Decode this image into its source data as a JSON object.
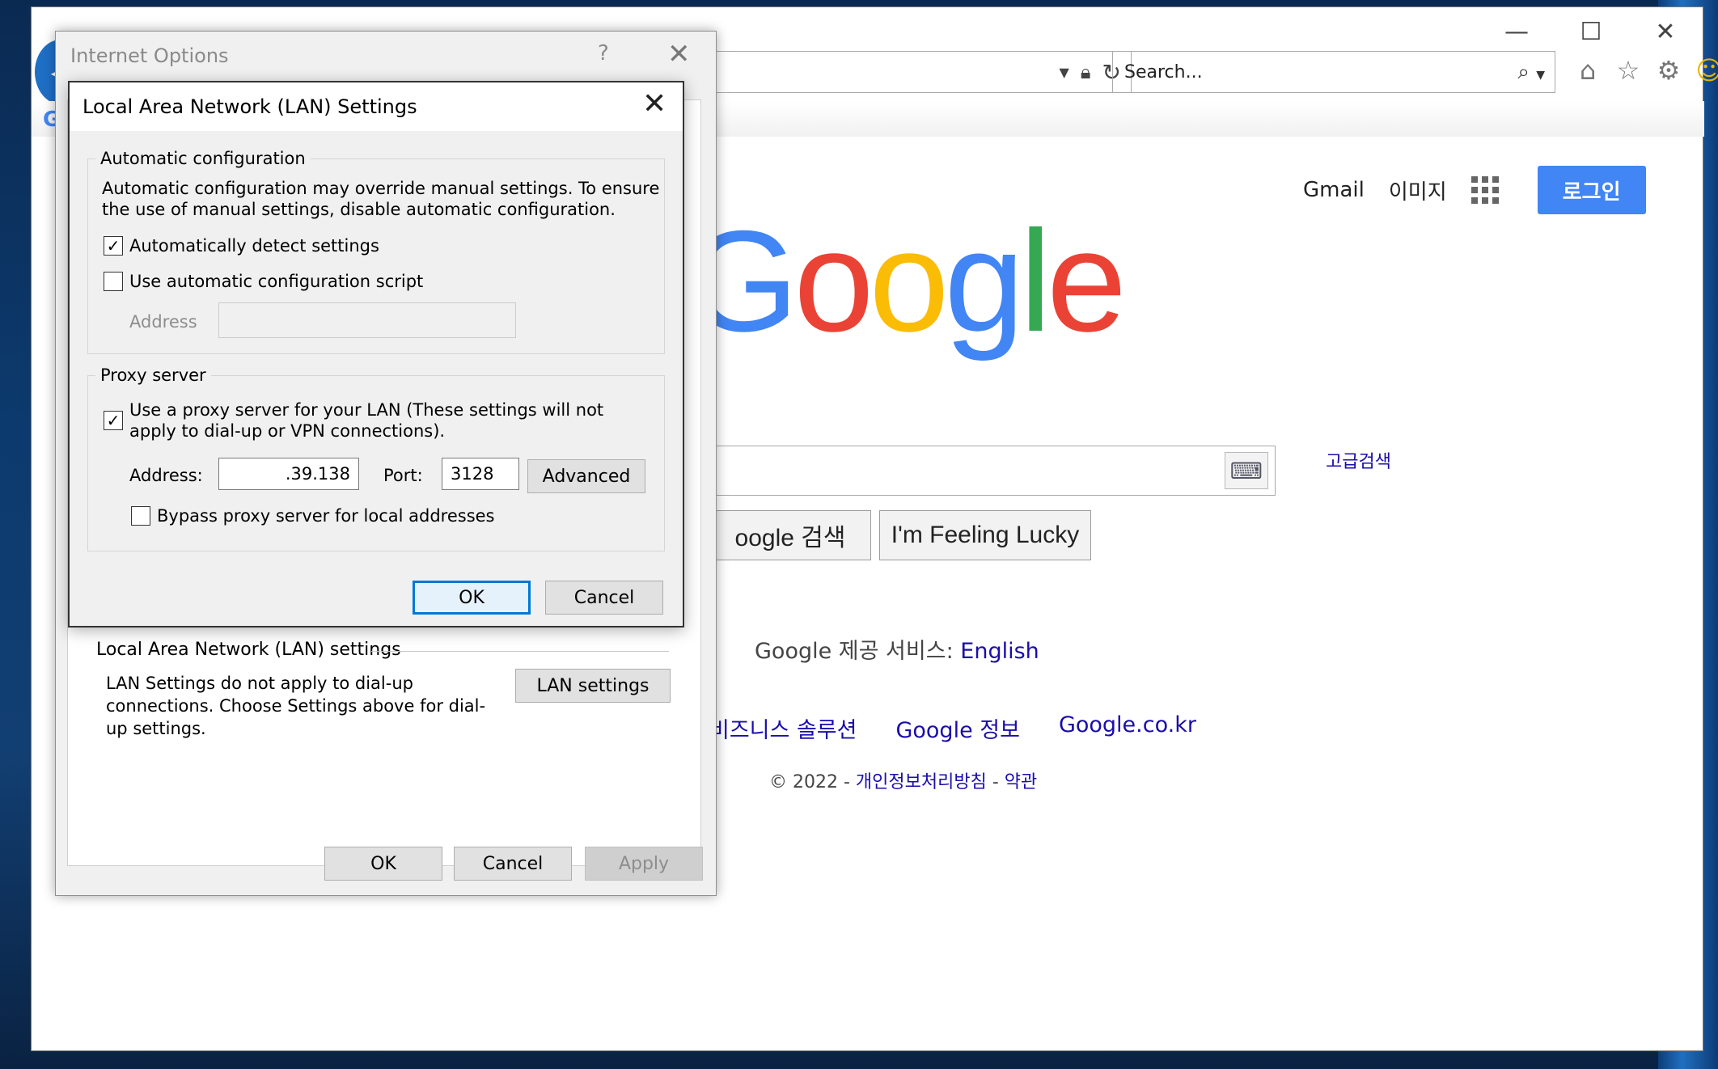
{
  "browser": {
    "search_placeholder": "Search...",
    "window_controls": {
      "minimize": "—",
      "maximize": "☐",
      "close": "✕"
    },
    "toolbar_icons": [
      "home-icon",
      "favorites-star-icon",
      "settings-gear-icon",
      "feedback-smiley-icon"
    ]
  },
  "google": {
    "nav_gmail": "Gmail",
    "nav_images": "이미지",
    "login_label": "로그인",
    "logo_letters": [
      "G",
      "o",
      "o",
      "g",
      "l",
      "e"
    ],
    "advanced_search": "고급검색",
    "search_button": "oogle 검색",
    "lucky_button": "I'm Feeling Lucky",
    "offered_in_prefix": "Google 제공 서비스:",
    "offered_in_language": "English",
    "links": [
      "비즈니스 솔루션",
      "Google 정보",
      "Google.co.kr"
    ],
    "footer_prefix": "© 2022 - ",
    "footer_privacy": "개인정보처리방침",
    "footer_sep": " - ",
    "footer_terms": "약관"
  },
  "internet_options": {
    "title": "Internet Options",
    "help": "?",
    "lan_section_label": "Local Area Network (LAN) settings",
    "lan_section_desc": "LAN Settings do not apply to dial-up connections. Choose Settings above for dial-up settings.",
    "lan_settings_button": "LAN settings",
    "ok": "OK",
    "cancel": "Cancel",
    "apply": "Apply"
  },
  "lan_settings": {
    "title": "Local Area Network (LAN) Settings",
    "auto_config": {
      "group_label": "Automatic configuration",
      "description": "Automatic configuration may override manual settings.  To ensure the use of manual settings, disable automatic configuration.",
      "auto_detect_label": "Automatically detect settings",
      "auto_detect_checked": true,
      "use_script_label": "Use automatic configuration script",
      "use_script_checked": false,
      "address_label": "Address",
      "address_value": ""
    },
    "proxy": {
      "group_label": "Proxy server",
      "use_proxy_label": "Use a proxy server for your LAN (These settings will not apply to dial-up or VPN connections).",
      "use_proxy_checked": true,
      "address_label": "Address:",
      "address_value": ".39.138",
      "port_label": "Port:",
      "port_value": "3128",
      "advanced_button": "Advanced",
      "bypass_label": "Bypass proxy server for local addresses",
      "bypass_checked": false
    },
    "ok": "OK",
    "cancel": "Cancel"
  }
}
